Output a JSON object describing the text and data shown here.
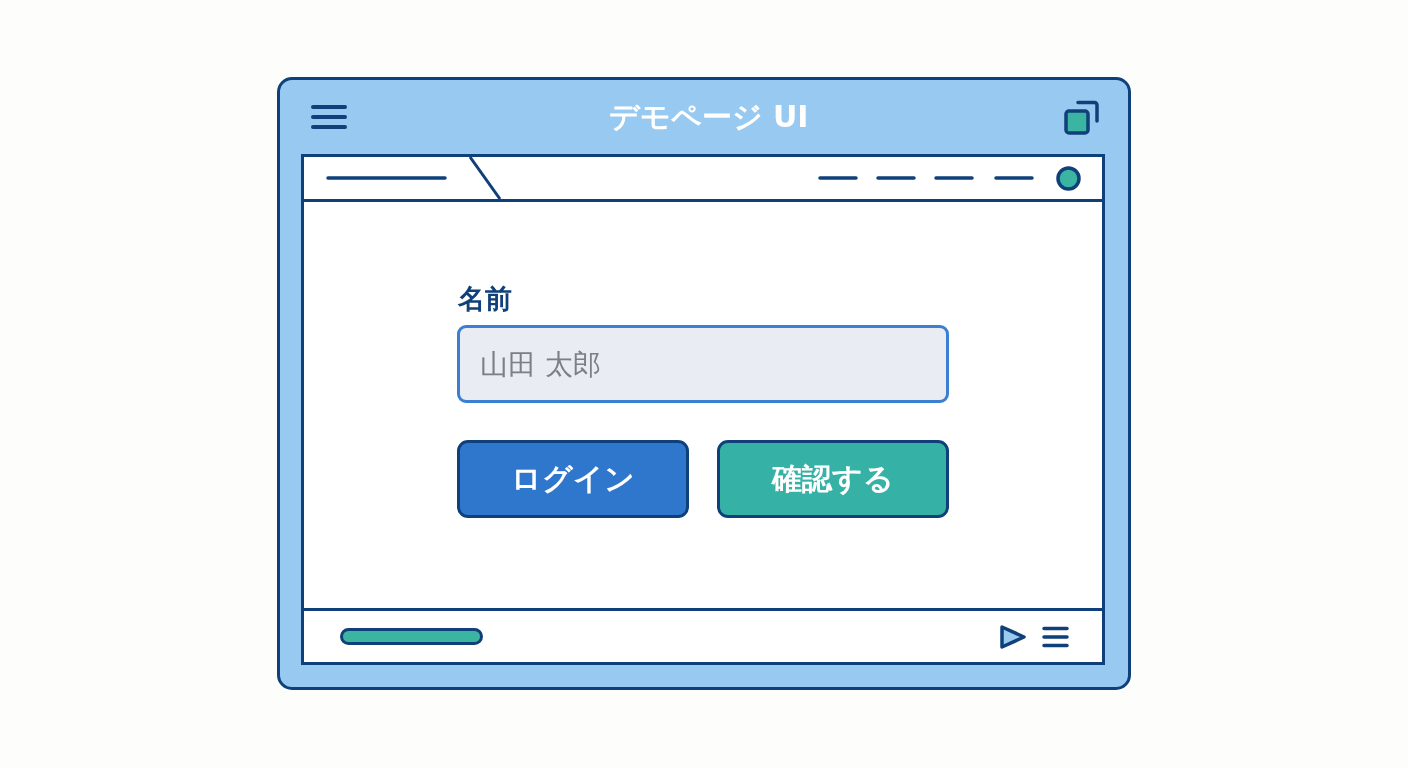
{
  "window": {
    "title": "デモページ UI"
  },
  "form": {
    "name_label": "名前",
    "name_field": {
      "placeholder": "山田 太郎"
    }
  },
  "buttons": [
    {
      "label": "ログイン",
      "kind": "primary"
    },
    {
      "label": "確認する",
      "kind": "secondary"
    }
  ]
}
